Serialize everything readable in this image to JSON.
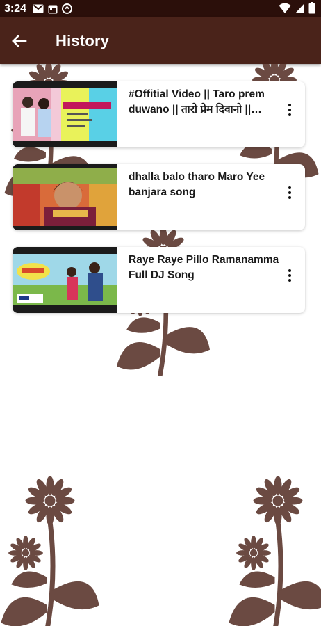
{
  "status_bar": {
    "time": "3:24",
    "left_icons": [
      "gmail-icon",
      "calendar-icon",
      "sync-icon"
    ],
    "right_icons": [
      "wifi-icon",
      "signal-icon",
      "battery-icon"
    ]
  },
  "app_bar": {
    "title": "History",
    "back_icon": "arrow-left-icon"
  },
  "colors": {
    "status_bar": "#2b0f0a",
    "app_bar": "#4a231a",
    "decoration": "#6b4a42"
  },
  "history": [
    {
      "title": "#Offitial Video || Taro prem duwano || तारो प्रेम दिवानो || Banjara Song",
      "thumbnail": "thumb-1"
    },
    {
      "title": "dhalla balo tharo Maro Yee banjara song",
      "thumbnail": "thumb-2"
    },
    {
      "title": "Raye Raye Pillo Ramanamma Full DJ Song",
      "thumbnail": "thumb-3"
    }
  ]
}
